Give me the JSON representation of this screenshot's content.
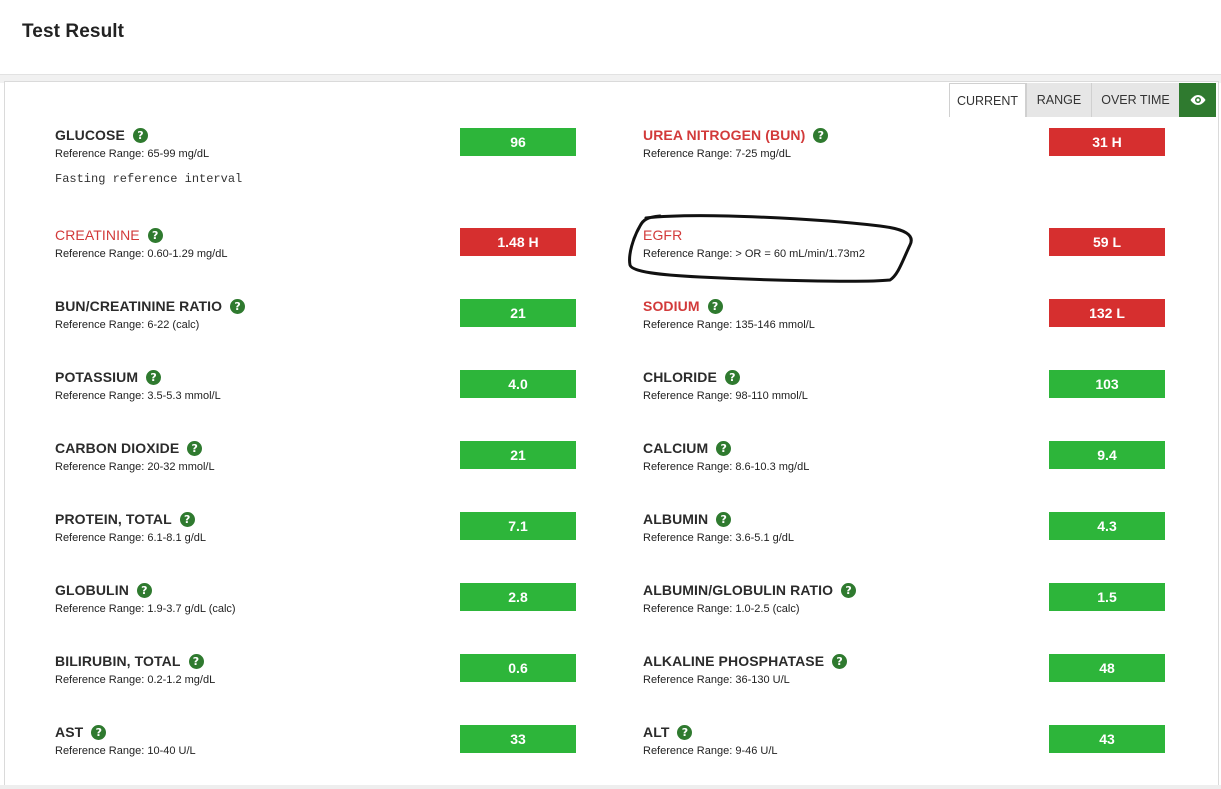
{
  "page": {
    "title": "Test Result"
  },
  "view_tabs": {
    "current": "CURRENT",
    "range": "RANGE",
    "over_time": "OVER TIME",
    "eye_icon": "eye-icon"
  },
  "colors": {
    "normal": "#2db53a",
    "abnormal": "#d62f2f",
    "abnormal_text": "#d23a3a",
    "accent_green": "#2f7a2f"
  },
  "left_column": [
    {
      "name": "GLUCOSE",
      "ref": "Reference Range: 65-99 mg/dL",
      "value": "96",
      "status": "normal",
      "note": "Fasting reference interval"
    },
    {
      "name": "CREATININE",
      "ref": "Reference Range: 0.60-1.29 mg/dL",
      "value": "1.48 H",
      "status": "abnormal"
    },
    {
      "name": "BUN/CREATININE RATIO",
      "ref": "Reference Range: 6-22 (calc)",
      "value": "21",
      "status": "normal"
    },
    {
      "name": "POTASSIUM",
      "ref": "Reference Range: 3.5-5.3 mmol/L",
      "value": "4.0",
      "status": "normal"
    },
    {
      "name": "CARBON DIOXIDE",
      "ref": "Reference Range: 20-32 mmol/L",
      "value": "21",
      "status": "normal"
    },
    {
      "name": "PROTEIN, TOTAL",
      "ref": "Reference Range: 6.1-8.1 g/dL",
      "value": "7.1",
      "status": "normal"
    },
    {
      "name": "GLOBULIN",
      "ref": "Reference Range: 1.9-3.7 g/dL (calc)",
      "value": "2.8",
      "status": "normal"
    },
    {
      "name": "BILIRUBIN, TOTAL",
      "ref": "Reference Range: 0.2-1.2 mg/dL",
      "value": "0.6",
      "status": "normal"
    },
    {
      "name": "AST",
      "ref": "Reference Range: 10-40 U/L",
      "value": "33",
      "status": "normal"
    }
  ],
  "right_column": [
    {
      "name": "UREA NITROGEN (BUN)",
      "ref": "Reference Range: 7-25 mg/dL",
      "value": "31 H",
      "status": "abnormal"
    },
    {
      "name": "EGFR",
      "ref": "Reference Range: > OR = 60 mL/min/1.73m2",
      "value": "59 L",
      "status": "abnormal"
    },
    {
      "name": "SODIUM",
      "ref": "Reference Range: 135-146 mmol/L",
      "value": "132 L",
      "status": "abnormal"
    },
    {
      "name": "CHLORIDE",
      "ref": "Reference Range: 98-110 mmol/L",
      "value": "103",
      "status": "normal"
    },
    {
      "name": "CALCIUM",
      "ref": "Reference Range: 8.6-10.3 mg/dL",
      "value": "9.4",
      "status": "normal"
    },
    {
      "name": "ALBUMIN",
      "ref": "Reference Range: 3.6-5.1 g/dL",
      "value": "4.3",
      "status": "normal"
    },
    {
      "name": "ALBUMIN/GLOBULIN RATIO",
      "ref": "Reference Range: 1.0-2.5 (calc)",
      "value": "1.5",
      "status": "normal"
    },
    {
      "name": "ALKALINE PHOSPHATASE",
      "ref": "Reference Range: 36-130 U/L",
      "value": "48",
      "status": "normal"
    },
    {
      "name": "ALT",
      "ref": "Reference Range: 9-46 U/L",
      "value": "43",
      "status": "normal"
    }
  ]
}
